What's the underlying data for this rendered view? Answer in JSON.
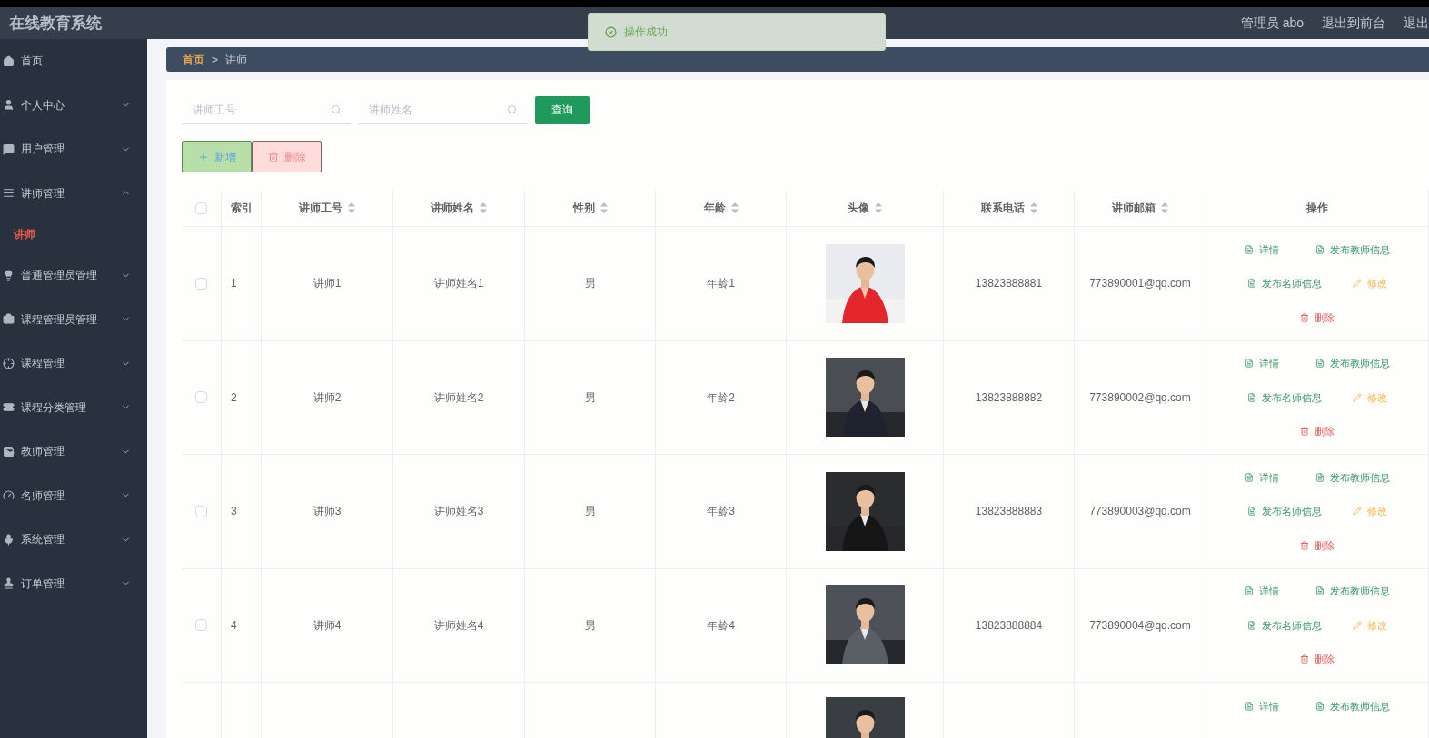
{
  "header": {
    "title": "在线教育系统",
    "user": "管理员 abo",
    "links": [
      "退出到前台",
      "退出"
    ]
  },
  "toast": {
    "kind": "success",
    "message": "操作成功"
  },
  "sidebar": {
    "items": [
      {
        "label": "首页"
      },
      {
        "label": "个人中心",
        "expanded": false
      },
      {
        "label": "用户管理",
        "expanded": false
      },
      {
        "label": "讲师管理",
        "expanded": true,
        "children": [
          {
            "label": "讲师",
            "selected": true
          }
        ]
      },
      {
        "label": "普通管理员管理",
        "expanded": false
      },
      {
        "label": "课程管理员管理",
        "expanded": false
      },
      {
        "label": "课程管理",
        "expanded": false
      },
      {
        "label": "课程分类管理",
        "expanded": false
      },
      {
        "label": "教师管理",
        "expanded": false
      },
      {
        "label": "名师管理",
        "expanded": false
      },
      {
        "label": "系统管理",
        "expanded": false
      },
      {
        "label": "订单管理",
        "expanded": false
      }
    ]
  },
  "breadcrumb": {
    "items": [
      "首页",
      "讲师"
    ],
    "separator": ">"
  },
  "search": {
    "fields": [
      {
        "placeholder": "讲师工号"
      },
      {
        "placeholder": "讲师姓名"
      }
    ],
    "button": "查询"
  },
  "actions": {
    "add": "新增",
    "delete": "删除"
  },
  "table": {
    "select_all_checked": false,
    "columns": [
      {
        "label": "索引",
        "sortable": false
      },
      {
        "label": "讲师工号",
        "sortable": true
      },
      {
        "label": "讲师姓名",
        "sortable": true
      },
      {
        "label": "性别",
        "sortable": true
      },
      {
        "label": "年龄",
        "sortable": true
      },
      {
        "label": "头像",
        "sortable": true
      },
      {
        "label": "联系电话",
        "sortable": true
      },
      {
        "label": "讲师邮箱",
        "sortable": true
      },
      {
        "label": "操作",
        "sortable": false
      }
    ],
    "rows": [
      {
        "checked": false,
        "index": "1",
        "id": "讲师1",
        "name": "讲师姓名1",
        "gender": "男",
        "age": "年龄1",
        "phone": "13823888881",
        "email": "773890001@qq.com",
        "actions": [
          {
            "label": "详情",
            "kind": "detail"
          },
          {
            "label": "发布教师信息",
            "kind": "publish"
          },
          {
            "label": "发布名师信息",
            "kind": "publish"
          },
          {
            "label": "修改",
            "kind": "edit"
          },
          {
            "label": "删除",
            "kind": "delete"
          }
        ]
      },
      {
        "checked": false,
        "index": "2",
        "id": "讲师2",
        "name": "讲师姓名2",
        "gender": "男",
        "age": "年龄2",
        "phone": "13823888882",
        "email": "773890002@qq.com",
        "actions": [
          {
            "label": "详情",
            "kind": "detail"
          },
          {
            "label": "发布教师信息",
            "kind": "publish"
          },
          {
            "label": "发布名师信息",
            "kind": "publish"
          },
          {
            "label": "修改",
            "kind": "edit"
          },
          {
            "label": "删除",
            "kind": "delete"
          }
        ]
      },
      {
        "checked": false,
        "index": "3",
        "id": "讲师3",
        "name": "讲师姓名3",
        "gender": "男",
        "age": "年龄3",
        "phone": "13823888883",
        "email": "773890003@qq.com",
        "actions": [
          {
            "label": "详情",
            "kind": "detail"
          },
          {
            "label": "发布教师信息",
            "kind": "publish"
          },
          {
            "label": "发布名师信息",
            "kind": "publish"
          },
          {
            "label": "修改",
            "kind": "edit"
          },
          {
            "label": "删除",
            "kind": "delete"
          }
        ]
      },
      {
        "checked": false,
        "index": "4",
        "id": "讲师4",
        "name": "讲师姓名4",
        "gender": "男",
        "age": "年龄4",
        "phone": "13823888884",
        "email": "773890004@qq.com",
        "actions": [
          {
            "label": "详情",
            "kind": "detail"
          },
          {
            "label": "发布教师信息",
            "kind": "publish"
          },
          {
            "label": "发布名师信息",
            "kind": "publish"
          },
          {
            "label": "修改",
            "kind": "edit"
          },
          {
            "label": "删除",
            "kind": "delete"
          }
        ]
      }
    ],
    "partial_row": {
      "actions": [
        {
          "label": "详情",
          "kind": "detail"
        },
        {
          "label": "发布教师信息",
          "kind": "publish"
        }
      ]
    }
  }
}
